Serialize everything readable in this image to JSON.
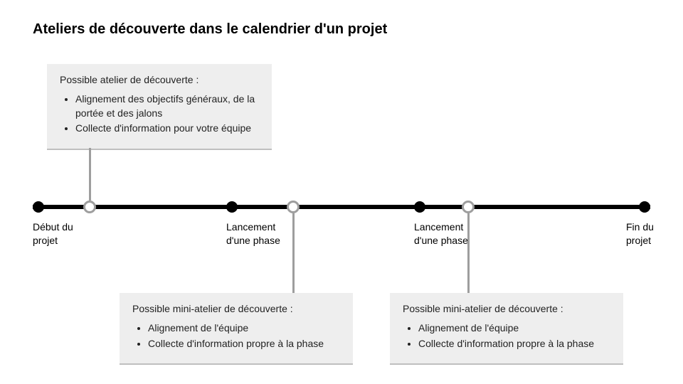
{
  "title": "Ateliers de découverte dans le calendrier d'un projet",
  "milestones": {
    "m1": "Début du projet",
    "m2": "Lancement d'une phase",
    "m3": "Lancement d'une phase",
    "m4": "Fin du projet"
  },
  "callout_top": {
    "heading": "Possible atelier de découverte :",
    "b1": "Alignement des objectifs généraux, de la portée et des jalons",
    "b2": "Collecte d'information pour votre équipe"
  },
  "callout_a": {
    "heading": "Possible mini-atelier de découverte :",
    "b1": "Alignement de l'équipe",
    "b2": "Collecte d'information propre à la phase"
  },
  "callout_b": {
    "heading": "Possible mini-atelier de découverte :",
    "b1": "Alignement de l'équipe",
    "b2": "Collecte d'information propre à la phase"
  }
}
